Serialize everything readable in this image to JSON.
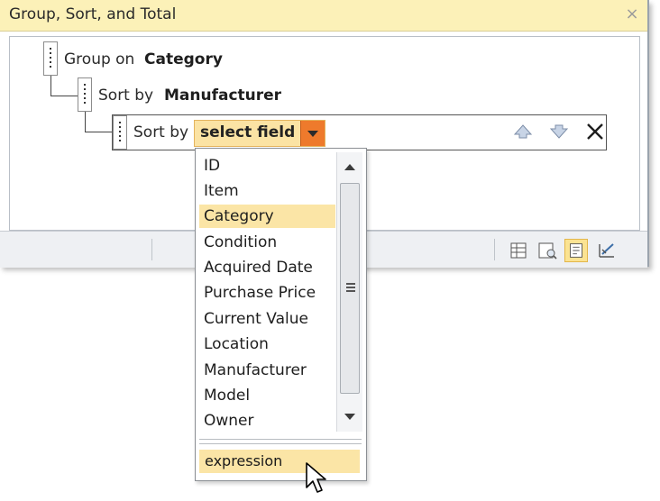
{
  "window": {
    "title": "Group, Sort, and Total",
    "close_glyph": "×"
  },
  "levels": [
    {
      "prefix": "Group on",
      "field": "Category"
    },
    {
      "prefix": "Sort by",
      "field": "Manufacturer"
    },
    {
      "prefix": "Sort by",
      "field": "select field"
    }
  ],
  "icons": {
    "move_up": "move-up-icon",
    "move_down": "move-down-icon",
    "delete": "delete-icon"
  },
  "field_list": {
    "items": [
      "ID",
      "Item",
      "Category",
      "Condition",
      "Acquired Date",
      "Purchase Price",
      "Current Value",
      "Location",
      "Manufacturer",
      "Model",
      "Owner"
    ],
    "highlighted": "Category",
    "expression_label": "expression"
  },
  "colors": {
    "title_bar": "#fcf1b8",
    "selection": "#fbe5a6",
    "dropdown_button": "#ee7a2c"
  }
}
